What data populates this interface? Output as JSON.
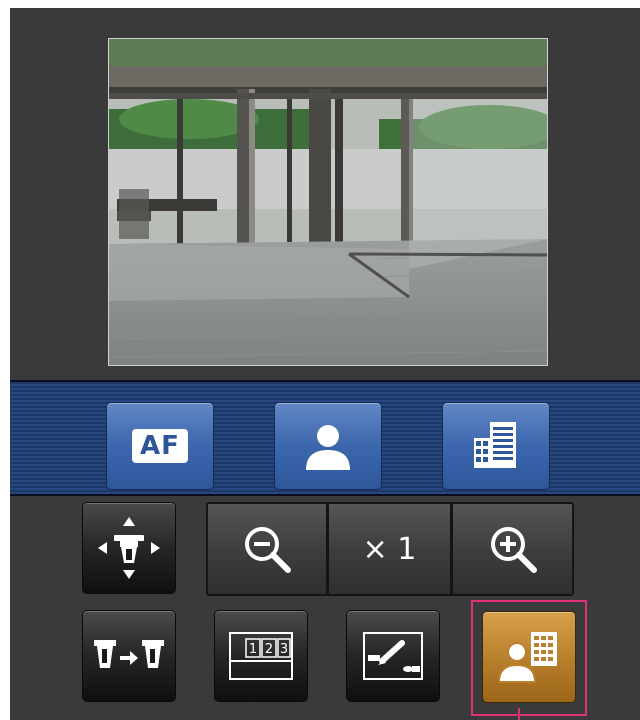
{
  "camera": {
    "image_icon": "camera-live-image"
  },
  "mode_buttons": {
    "af": {
      "label": "AF",
      "icon": "af-icon"
    },
    "person": {
      "icon": "person-icon"
    },
    "building": {
      "icon": "building-grid-icon"
    }
  },
  "controls": {
    "ptz": {
      "icon": "pan-tilt-camera-icon"
    },
    "zoom_out": {
      "icon": "zoom-out-icon"
    },
    "zoom_level": "× 1",
    "zoom_in": {
      "icon": "zoom-in-icon"
    },
    "camera_switch": {
      "icon": "camera-switch-icon"
    },
    "preset": {
      "icon": "preset-position-icon",
      "numbers": [
        "1",
        "2",
        "3"
      ]
    },
    "edit": {
      "icon": "pen-edit-icon"
    },
    "person_building": {
      "icon": "person-building-icon",
      "state": "selected"
    }
  },
  "colors": {
    "accent_blue": "#3d68ad",
    "selected_gold": "#b9802d",
    "highlight_frame": "#e0307a"
  }
}
